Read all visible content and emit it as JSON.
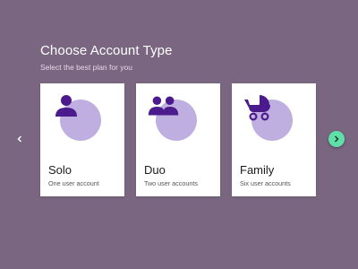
{
  "header": {
    "title": "Choose Account Type",
    "subtitle": "Select the best plan for you"
  },
  "plans": [
    {
      "name": "Solo",
      "description": "One user account",
      "icon": "single-user-icon"
    },
    {
      "name": "Duo",
      "description": "Two user accounts",
      "icon": "two-users-icon"
    },
    {
      "name": "Family",
      "description": "Six user accounts",
      "icon": "baby-stroller-icon"
    }
  ],
  "colors": {
    "background": "#7a6681",
    "card": "#ffffff",
    "icon": "#4b1a8c",
    "icon_backdrop": "#bfaee0",
    "next_button": "#5fe0a8"
  },
  "navigation": {
    "prev_icon": "chevron-left-icon",
    "next_icon": "chevron-right-icon"
  }
}
